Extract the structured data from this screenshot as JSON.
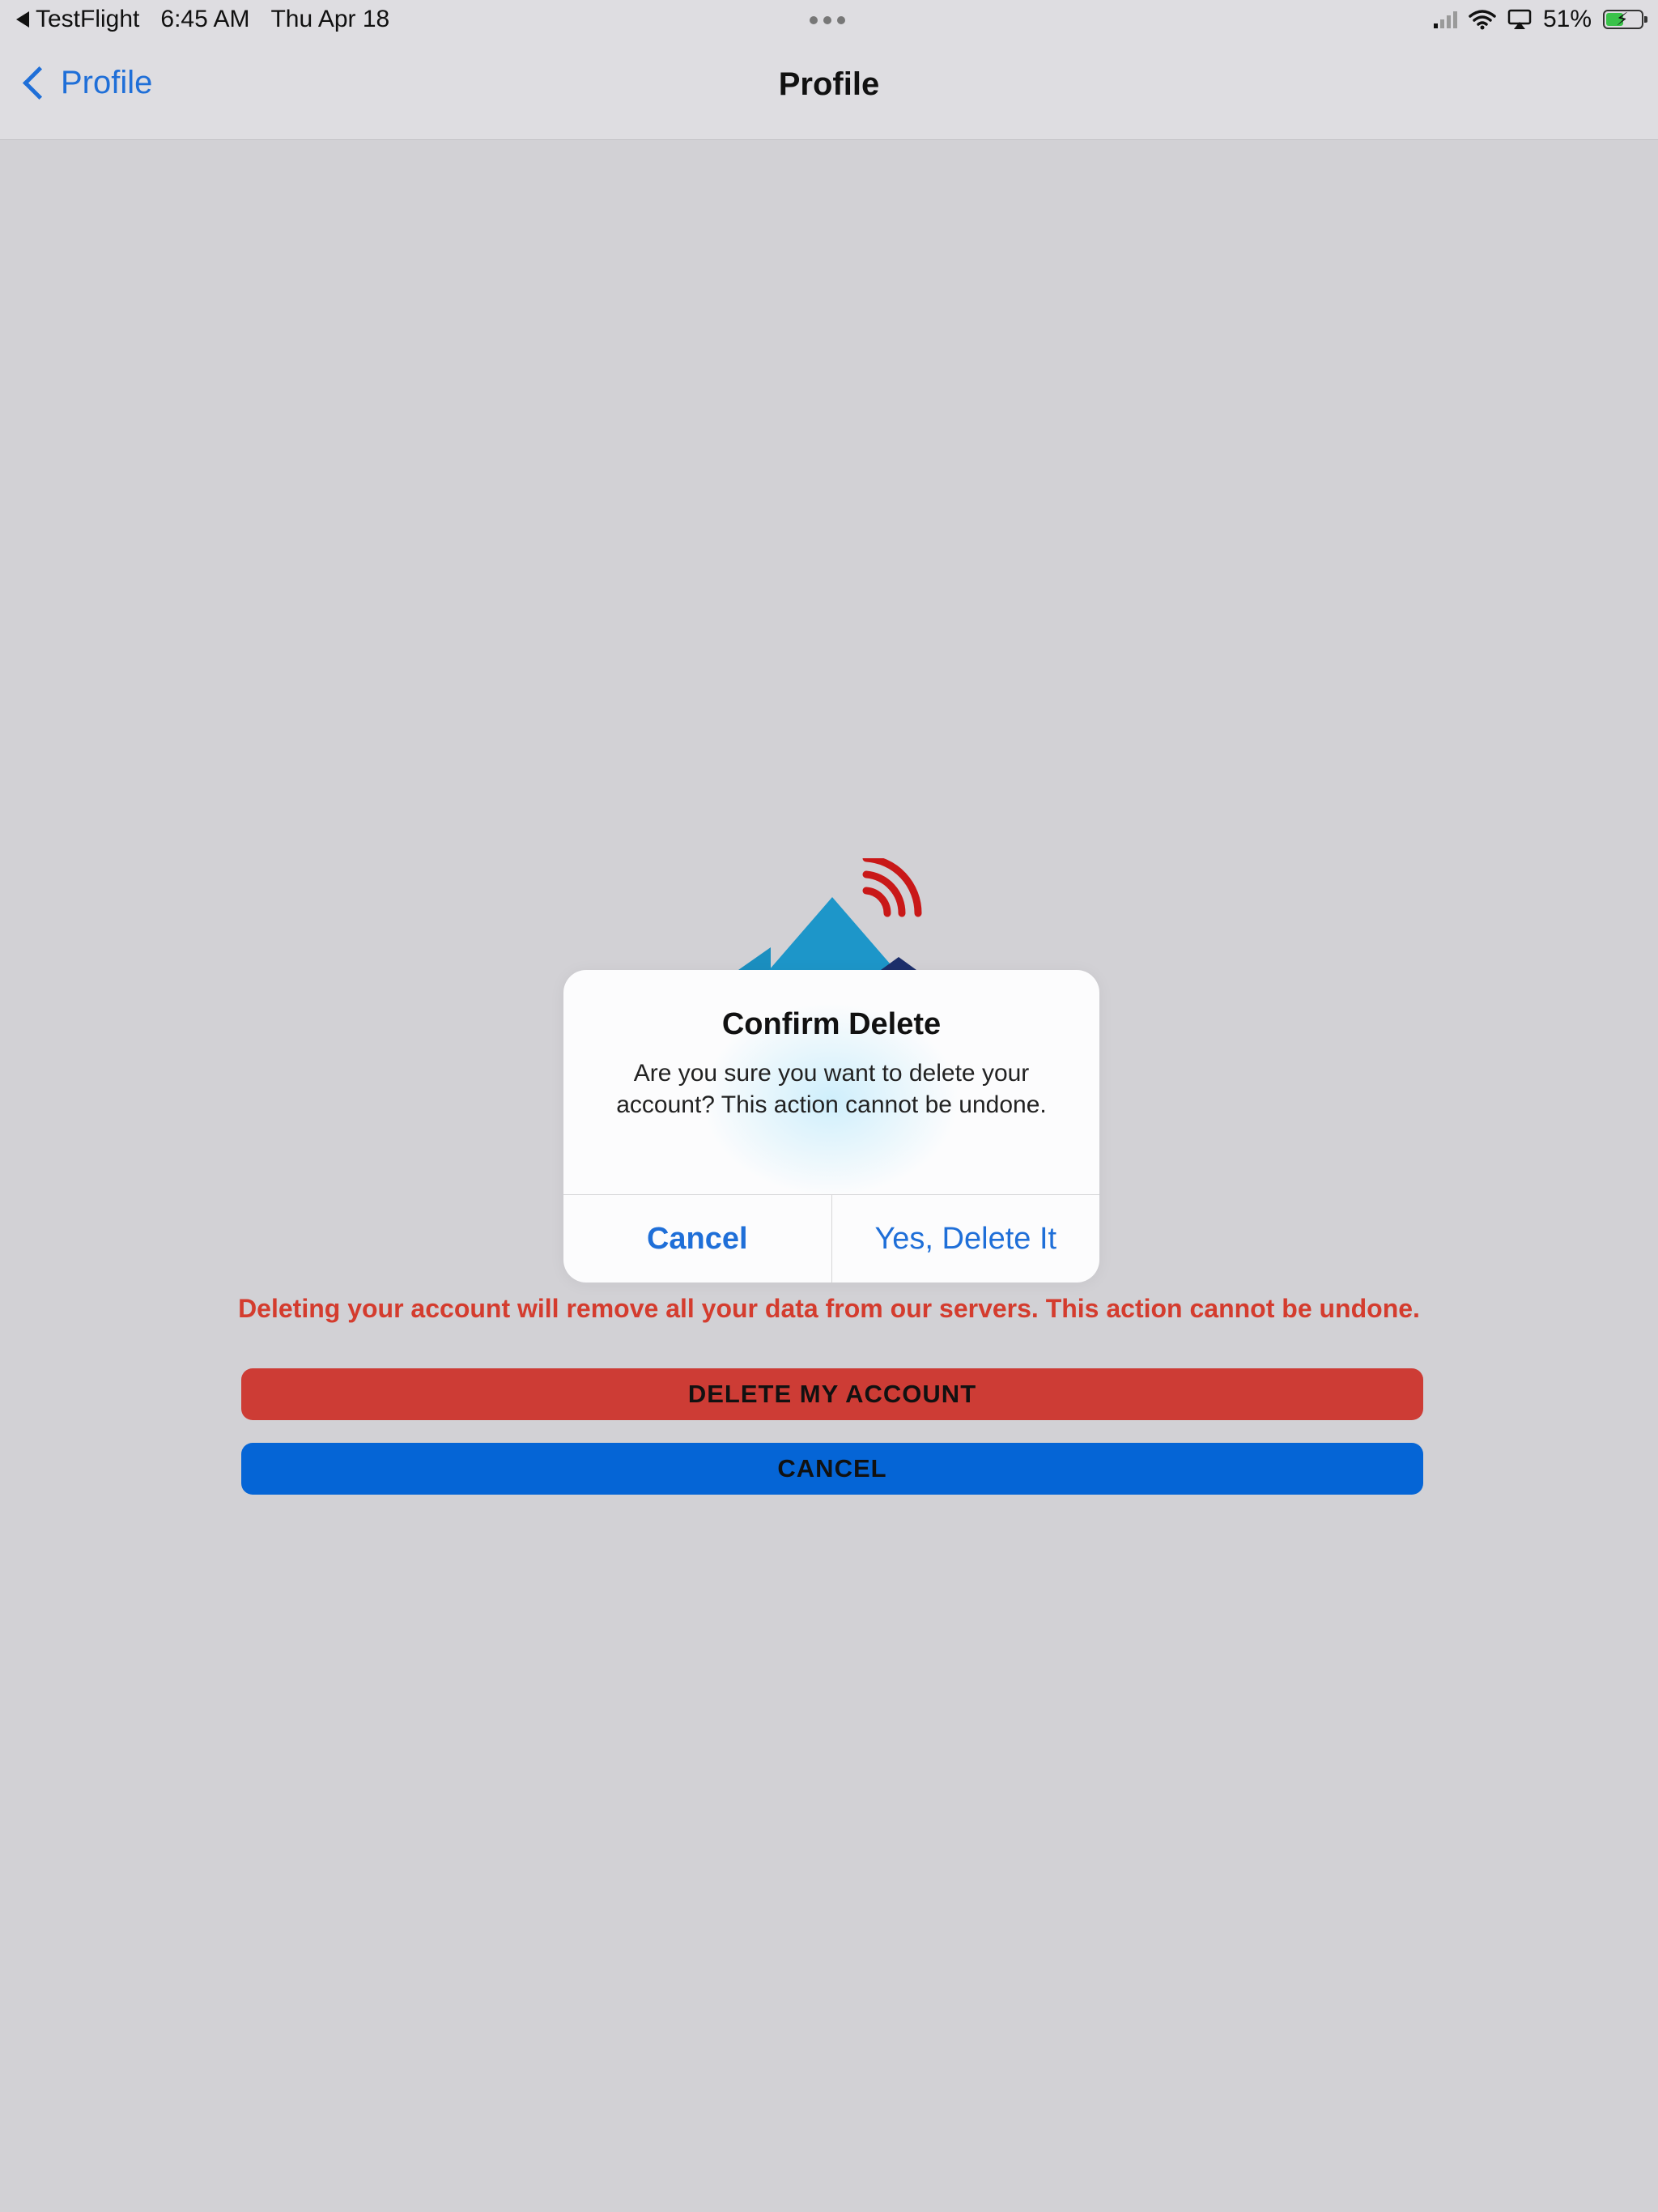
{
  "status_bar": {
    "back_app": "TestFlight",
    "time": "6:45 AM",
    "date": "Thu Apr 18",
    "battery": "51%",
    "battery_level": 0.51
  },
  "nav": {
    "back_label": "Profile",
    "title": "Profile"
  },
  "alert": {
    "title": "Confirm Delete",
    "message": "Are you sure you want to delete your account? This action cannot be undone.",
    "cancel_label": "Cancel",
    "confirm_label": "Yes, Delete It"
  },
  "warning_text": "Deleting your account will remove all your data from our servers. This action cannot be undone.",
  "buttons": {
    "delete_label": "DELETE MY ACCOUNT",
    "cancel_label": "CANCEL"
  },
  "colors": {
    "accent": "#1f6fd8",
    "danger": "#cd3c35",
    "primary": "#0565d6",
    "warning_text": "#d43c2e",
    "background": "#d2d1d5"
  }
}
